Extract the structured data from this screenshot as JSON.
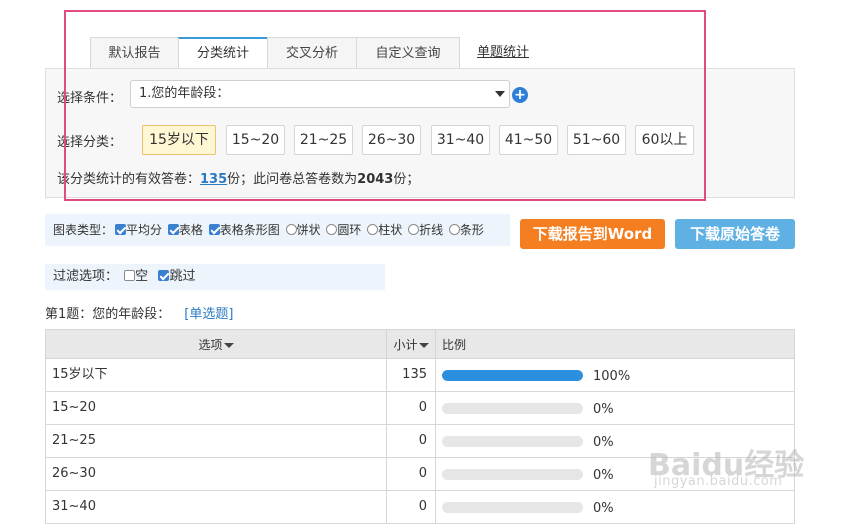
{
  "tabs": [
    {
      "label": "默认报告"
    },
    {
      "label": "分类统计"
    },
    {
      "label": "交叉分析"
    },
    {
      "label": "自定义查询"
    },
    {
      "label": "单题统计"
    }
  ],
  "condition": {
    "label": "选择条件：",
    "value": "1.您的年龄段："
  },
  "category": {
    "label": "选择分类：",
    "options": [
      "15岁以下",
      "15~20",
      "21~25",
      "26~30",
      "31~40",
      "41~50",
      "51~60",
      "60以上"
    ],
    "selected": "15岁以下"
  },
  "info": {
    "prefix": "该分类统计的有效答卷：",
    "valid_count": "135",
    "middle": "份；此问卷总答卷数为",
    "total_count": "2043",
    "suffix": "份；"
  },
  "chart_types": {
    "label": "图表类型：",
    "checkboxes": [
      {
        "label": "平均分",
        "checked": true
      },
      {
        "label": "表格",
        "checked": true
      },
      {
        "label": "表格条形图",
        "checked": true
      }
    ],
    "radios": [
      {
        "label": "饼状"
      },
      {
        "label": "圆环"
      },
      {
        "label": "柱状"
      },
      {
        "label": "折线"
      },
      {
        "label": "条形"
      }
    ]
  },
  "buttons": {
    "download_word": "下载报告到Word",
    "download_raw": "下载原始答卷"
  },
  "filter": {
    "label": "过滤选项：",
    "empty_label": "空",
    "skip_label": "跳过"
  },
  "question": {
    "title": "第1题：您的年龄段：",
    "type": "[单选题]"
  },
  "table": {
    "headers": {
      "option": "选项",
      "count": "小计",
      "ratio": "比例"
    },
    "rows": [
      {
        "option": "15岁以下",
        "count": "135",
        "percent": "100%",
        "fraction": 1.0
      },
      {
        "option": "15~20",
        "count": "0",
        "percent": "0%",
        "fraction": 0
      },
      {
        "option": "21~25",
        "count": "0",
        "percent": "0%",
        "fraction": 0
      },
      {
        "option": "26~30",
        "count": "0",
        "percent": "0%",
        "fraction": 0
      },
      {
        "option": "31~40",
        "count": "0",
        "percent": "0%",
        "fraction": 0
      }
    ]
  },
  "watermark": {
    "main": "Baidu经验",
    "sub": "jingyan.baidu.com"
  },
  "colors": {
    "accent": "#3a9bd8",
    "highlight_border": "#e24a86",
    "orange_button": "#f57e20",
    "blue_button": "#5fb1e3",
    "bar_fill": "#2b8fdf"
  }
}
